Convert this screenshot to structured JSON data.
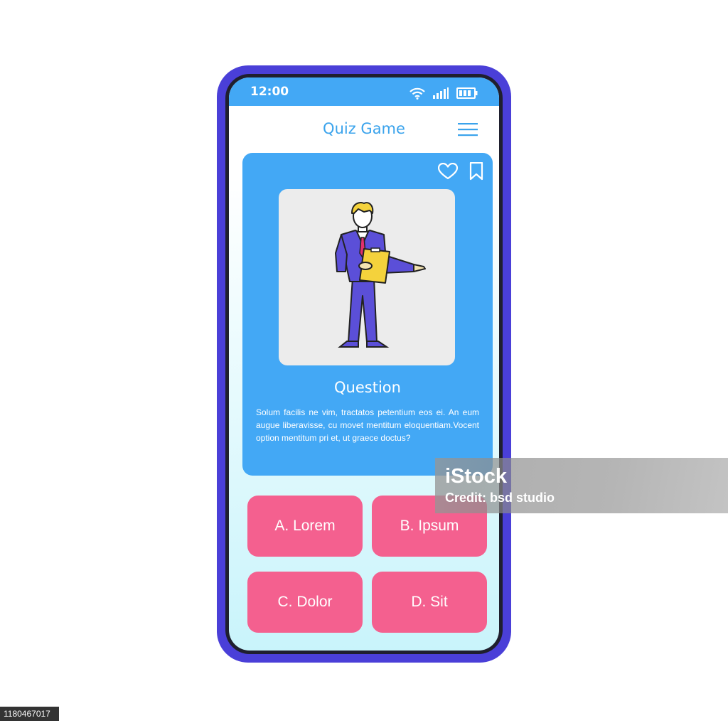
{
  "status_bar": {
    "time": "12:00"
  },
  "header": {
    "title": "Quiz Game"
  },
  "card": {
    "question_title": "Question",
    "question_text": "Solum facilis ne vim, tractatos petentium eos ei. An eum augue liberavisse, cu movet mentitum eloquentiam.Vocent option mentitum pri et, ut graece doctus?"
  },
  "answers": [
    "A. Lorem",
    "B. Ipsum",
    "C. Dolor",
    "D. Sit"
  ],
  "watermark": {
    "logo": "iStock",
    "credit": "Credit: bsd studio"
  },
  "stock_id": "1180467017",
  "icons": [
    "wifi-icon",
    "signal-icon",
    "battery-icon",
    "menu-icon",
    "heart-icon",
    "bookmark-icon"
  ],
  "colors": {
    "phone_frame": "#4a3fd8",
    "accent_blue": "#43a8f5",
    "answer_pink": "#f4608f",
    "title_blue": "#3aa3ec"
  }
}
